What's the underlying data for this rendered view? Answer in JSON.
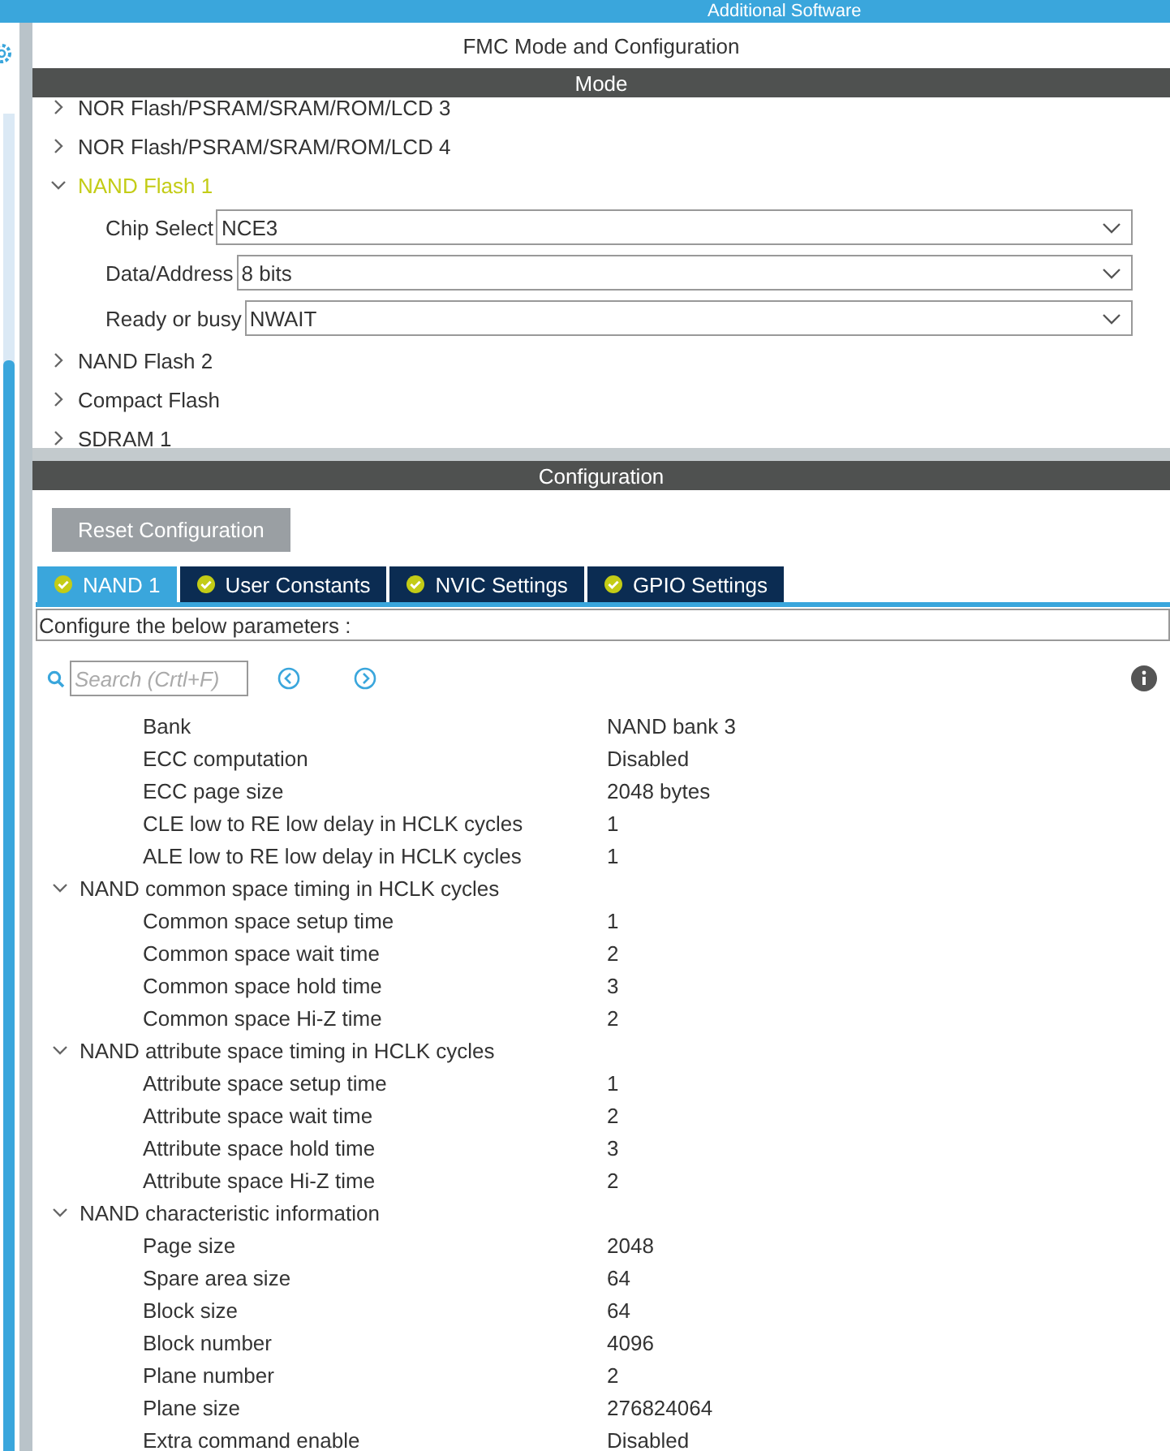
{
  "top_bar": {
    "title": "Additional Software"
  },
  "panel_title": "FMC Mode and Configuration",
  "mode": {
    "header": "Mode",
    "tree": [
      {
        "label": "NOR Flash/PSRAM/SRAM/ROM/LCD 3",
        "expanded": false,
        "enabled": false
      },
      {
        "label": "NOR Flash/PSRAM/SRAM/ROM/LCD 4",
        "expanded": false,
        "enabled": false
      },
      {
        "label": "NAND Flash 1",
        "expanded": true,
        "enabled": true,
        "fields": [
          {
            "label": "Chip Select",
            "value": "NCE3"
          },
          {
            "label": "Data/Address",
            "value": "8 bits"
          },
          {
            "label": "Ready or busy",
            "value": "NWAIT"
          }
        ]
      },
      {
        "label": "NAND Flash 2",
        "expanded": false,
        "enabled": false
      },
      {
        "label": "Compact Flash",
        "expanded": false,
        "enabled": false
      },
      {
        "label": "SDRAM 1",
        "expanded": false,
        "enabled": false
      }
    ]
  },
  "configuration": {
    "header": "Configuration",
    "reset_button": "Reset Configuration",
    "tabs": [
      {
        "label": "NAND 1",
        "selected": true
      },
      {
        "label": "User Constants",
        "selected": false
      },
      {
        "label": "NVIC Settings",
        "selected": false
      },
      {
        "label": "GPIO Settings",
        "selected": false
      }
    ],
    "description": "Configure the below parameters :",
    "search": {
      "placeholder": "Search (Crtl+F)"
    },
    "parameters": [
      {
        "kind": "item",
        "label": "Bank",
        "value": "NAND bank 3"
      },
      {
        "kind": "item",
        "label": "ECC computation",
        "value": "Disabled"
      },
      {
        "kind": "item",
        "label": "ECC page size",
        "value": "2048 bytes"
      },
      {
        "kind": "item",
        "label": "CLE low to RE low delay in HCLK cycles",
        "value": "1"
      },
      {
        "kind": "item",
        "label": "ALE low to RE low delay in HCLK cycles",
        "value": "1"
      },
      {
        "kind": "group",
        "label": "NAND common space timing in HCLK cycles",
        "expanded": true,
        "children": [
          {
            "kind": "item",
            "label": "Common space setup time",
            "value": "1"
          },
          {
            "kind": "item",
            "label": "Common space wait time",
            "value": "2"
          },
          {
            "kind": "item",
            "label": "Common space hold time",
            "value": "3"
          },
          {
            "kind": "item",
            "label": "Common space Hi-Z time",
            "value": "2"
          }
        ]
      },
      {
        "kind": "group",
        "label": "NAND attribute space timing in HCLK cycles",
        "expanded": true,
        "children": [
          {
            "kind": "item",
            "label": "Attribute space setup time",
            "value": "1"
          },
          {
            "kind": "item",
            "label": "Attribute space wait time",
            "value": "2"
          },
          {
            "kind": "item",
            "label": "Attribute space hold time",
            "value": "3"
          },
          {
            "kind": "item",
            "label": "Attribute space Hi-Z time",
            "value": "2"
          }
        ]
      },
      {
        "kind": "group",
        "label": "NAND characteristic information",
        "expanded": true,
        "children": [
          {
            "kind": "item",
            "label": "Page size",
            "value": "2048"
          },
          {
            "kind": "item",
            "label": "Spare area size",
            "value": "64"
          },
          {
            "kind": "item",
            "label": "Block size",
            "value": "64"
          },
          {
            "kind": "item",
            "label": "Block number",
            "value": "4096"
          },
          {
            "kind": "item",
            "label": "Plane number",
            "value": "2"
          },
          {
            "kind": "item",
            "label": "Plane size",
            "value": "276824064"
          },
          {
            "kind": "item",
            "label": "Extra command enable",
            "value": "Disabled"
          }
        ]
      }
    ]
  }
}
